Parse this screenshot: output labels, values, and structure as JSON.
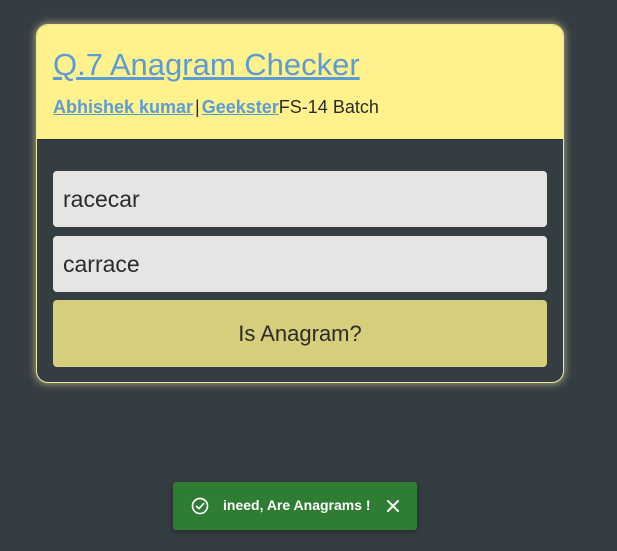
{
  "header": {
    "title": "Q.7 Anagram Checker",
    "author_link": "Abhishek kumar",
    "separator": "|",
    "org_link": "Geekster",
    "batch": "FS-14 Batch"
  },
  "form": {
    "first_word": "racecar",
    "second_word": "carrace",
    "submit_label": "Is Anagram?"
  },
  "toast": {
    "message": "ineed, Are Anagrams !",
    "icon": "check-circle-icon",
    "close_icon": "close-icon",
    "background_color": "#2e7d32"
  },
  "colors": {
    "page_background": "#343d42",
    "header_background": "#fff28c",
    "button_background": "#d6ce7a",
    "link_color": "#5b9bd6"
  }
}
